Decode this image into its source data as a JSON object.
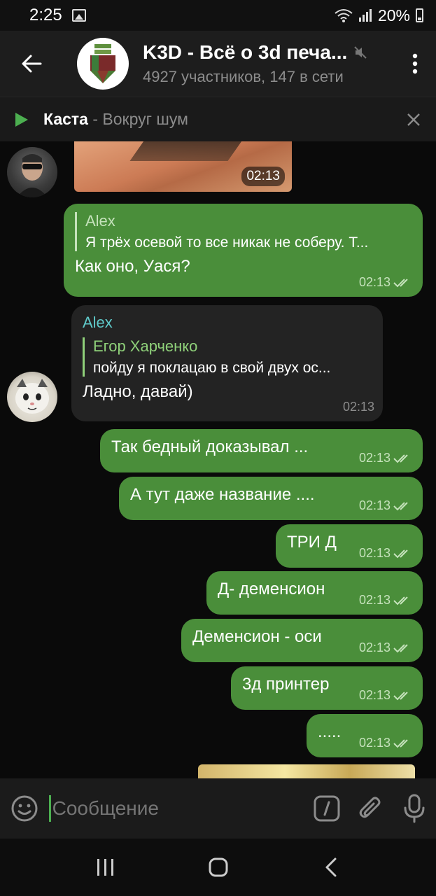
{
  "status": {
    "time": "2:25",
    "battery": "20%"
  },
  "header": {
    "title": "K3D - Всё о 3d печа...",
    "subtitle": "4927 участников, 147 в сети"
  },
  "audio": {
    "artist": "Каста",
    "separator": " - ",
    "track": "Вокруг шум"
  },
  "messages": [
    {
      "type": "image",
      "time": "02:13"
    },
    {
      "type": "outgoing",
      "reply_name": "Alex",
      "reply_text": "Я трёх осевой то все никак не соберу. Т...",
      "text": "Как оно, Уася?",
      "time": "02:13"
    },
    {
      "type": "incoming",
      "sender": "Alex",
      "reply_name": "Егор Харченко",
      "reply_text": "пойду я поклацаю в свой двух ос...",
      "text": "Ладно, давай)",
      "time": "02:13"
    },
    {
      "type": "outgoing",
      "text": "Так бедный доказывал ...",
      "time": "02:13"
    },
    {
      "type": "outgoing",
      "text": "А тут даже название ....",
      "time": "02:13"
    },
    {
      "type": "outgoing",
      "text": "ТРИ Д",
      "time": "02:13"
    },
    {
      "type": "outgoing",
      "text": "Д- деменсион",
      "time": "02:13"
    },
    {
      "type": "outgoing",
      "text": "Деменсион - оси",
      "time": "02:13"
    },
    {
      "type": "outgoing",
      "text": "3д принтер",
      "time": "02:13"
    },
    {
      "type": "outgoing",
      "text": ".....",
      "time": "02:13"
    }
  ],
  "composer": {
    "placeholder": "Сообщение"
  },
  "colors": {
    "outgoing_bubble": "#4a8e3a",
    "incoming_bubble": "#232323",
    "accent": "#4caf50",
    "reply_name": "#8fd17a",
    "sender_name": "#5fc9c9"
  },
  "icons": [
    "back-arrow-icon",
    "mute-icon",
    "more-vert-icon",
    "play-icon",
    "close-icon",
    "double-check-icon",
    "emoji-icon",
    "command-slash-icon",
    "paperclip-icon",
    "microphone-icon",
    "recents-icon",
    "home-icon",
    "back-nav-icon",
    "wifi-icon",
    "signal-icon",
    "battery-icon",
    "gallery-icon"
  ]
}
